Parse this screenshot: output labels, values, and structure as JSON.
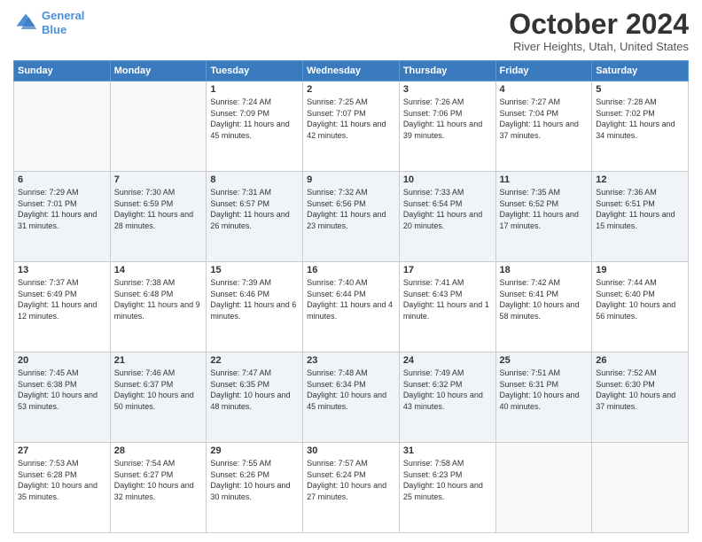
{
  "header": {
    "logo_line1": "General",
    "logo_line2": "Blue",
    "month": "October 2024",
    "location": "River Heights, Utah, United States"
  },
  "weekdays": [
    "Sunday",
    "Monday",
    "Tuesday",
    "Wednesday",
    "Thursday",
    "Friday",
    "Saturday"
  ],
  "weeks": [
    [
      {
        "day": "",
        "info": ""
      },
      {
        "day": "",
        "info": ""
      },
      {
        "day": "1",
        "info": "Sunrise: 7:24 AM\nSunset: 7:09 PM\nDaylight: 11 hours and 45 minutes."
      },
      {
        "day": "2",
        "info": "Sunrise: 7:25 AM\nSunset: 7:07 PM\nDaylight: 11 hours and 42 minutes."
      },
      {
        "day": "3",
        "info": "Sunrise: 7:26 AM\nSunset: 7:06 PM\nDaylight: 11 hours and 39 minutes."
      },
      {
        "day": "4",
        "info": "Sunrise: 7:27 AM\nSunset: 7:04 PM\nDaylight: 11 hours and 37 minutes."
      },
      {
        "day": "5",
        "info": "Sunrise: 7:28 AM\nSunset: 7:02 PM\nDaylight: 11 hours and 34 minutes."
      }
    ],
    [
      {
        "day": "6",
        "info": "Sunrise: 7:29 AM\nSunset: 7:01 PM\nDaylight: 11 hours and 31 minutes."
      },
      {
        "day": "7",
        "info": "Sunrise: 7:30 AM\nSunset: 6:59 PM\nDaylight: 11 hours and 28 minutes."
      },
      {
        "day": "8",
        "info": "Sunrise: 7:31 AM\nSunset: 6:57 PM\nDaylight: 11 hours and 26 minutes."
      },
      {
        "day": "9",
        "info": "Sunrise: 7:32 AM\nSunset: 6:56 PM\nDaylight: 11 hours and 23 minutes."
      },
      {
        "day": "10",
        "info": "Sunrise: 7:33 AM\nSunset: 6:54 PM\nDaylight: 11 hours and 20 minutes."
      },
      {
        "day": "11",
        "info": "Sunrise: 7:35 AM\nSunset: 6:52 PM\nDaylight: 11 hours and 17 minutes."
      },
      {
        "day": "12",
        "info": "Sunrise: 7:36 AM\nSunset: 6:51 PM\nDaylight: 11 hours and 15 minutes."
      }
    ],
    [
      {
        "day": "13",
        "info": "Sunrise: 7:37 AM\nSunset: 6:49 PM\nDaylight: 11 hours and 12 minutes."
      },
      {
        "day": "14",
        "info": "Sunrise: 7:38 AM\nSunset: 6:48 PM\nDaylight: 11 hours and 9 minutes."
      },
      {
        "day": "15",
        "info": "Sunrise: 7:39 AM\nSunset: 6:46 PM\nDaylight: 11 hours and 6 minutes."
      },
      {
        "day": "16",
        "info": "Sunrise: 7:40 AM\nSunset: 6:44 PM\nDaylight: 11 hours and 4 minutes."
      },
      {
        "day": "17",
        "info": "Sunrise: 7:41 AM\nSunset: 6:43 PM\nDaylight: 11 hours and 1 minute."
      },
      {
        "day": "18",
        "info": "Sunrise: 7:42 AM\nSunset: 6:41 PM\nDaylight: 10 hours and 58 minutes."
      },
      {
        "day": "19",
        "info": "Sunrise: 7:44 AM\nSunset: 6:40 PM\nDaylight: 10 hours and 56 minutes."
      }
    ],
    [
      {
        "day": "20",
        "info": "Sunrise: 7:45 AM\nSunset: 6:38 PM\nDaylight: 10 hours and 53 minutes."
      },
      {
        "day": "21",
        "info": "Sunrise: 7:46 AM\nSunset: 6:37 PM\nDaylight: 10 hours and 50 minutes."
      },
      {
        "day": "22",
        "info": "Sunrise: 7:47 AM\nSunset: 6:35 PM\nDaylight: 10 hours and 48 minutes."
      },
      {
        "day": "23",
        "info": "Sunrise: 7:48 AM\nSunset: 6:34 PM\nDaylight: 10 hours and 45 minutes."
      },
      {
        "day": "24",
        "info": "Sunrise: 7:49 AM\nSunset: 6:32 PM\nDaylight: 10 hours and 43 minutes."
      },
      {
        "day": "25",
        "info": "Sunrise: 7:51 AM\nSunset: 6:31 PM\nDaylight: 10 hours and 40 minutes."
      },
      {
        "day": "26",
        "info": "Sunrise: 7:52 AM\nSunset: 6:30 PM\nDaylight: 10 hours and 37 minutes."
      }
    ],
    [
      {
        "day": "27",
        "info": "Sunrise: 7:53 AM\nSunset: 6:28 PM\nDaylight: 10 hours and 35 minutes."
      },
      {
        "day": "28",
        "info": "Sunrise: 7:54 AM\nSunset: 6:27 PM\nDaylight: 10 hours and 32 minutes."
      },
      {
        "day": "29",
        "info": "Sunrise: 7:55 AM\nSunset: 6:26 PM\nDaylight: 10 hours and 30 minutes."
      },
      {
        "day": "30",
        "info": "Sunrise: 7:57 AM\nSunset: 6:24 PM\nDaylight: 10 hours and 27 minutes."
      },
      {
        "day": "31",
        "info": "Sunrise: 7:58 AM\nSunset: 6:23 PM\nDaylight: 10 hours and 25 minutes."
      },
      {
        "day": "",
        "info": ""
      },
      {
        "day": "",
        "info": ""
      }
    ]
  ]
}
